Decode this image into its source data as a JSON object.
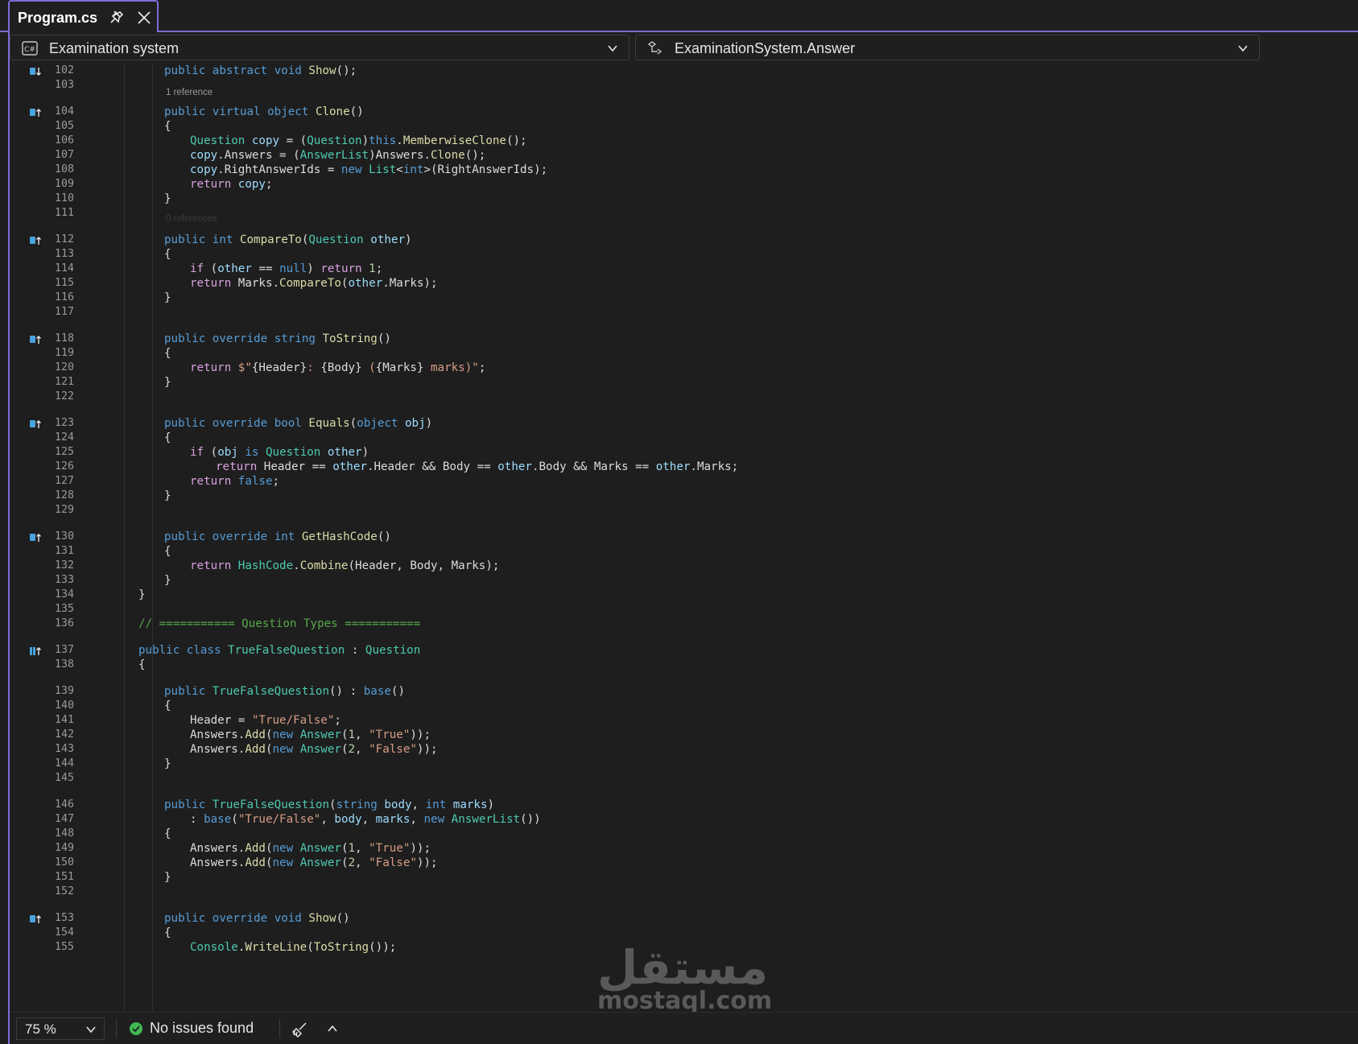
{
  "tab": {
    "title": "Program.cs"
  },
  "navbar": {
    "project": "Examination system",
    "member": "ExaminationSystem.Answer"
  },
  "colors": {
    "accent": "#7f6bd6",
    "background": "#1e1e1e",
    "keyword": "#569cd6",
    "type": "#4ec9b0",
    "method": "#dcdcaa",
    "string": "#d69d85",
    "comment": "#57a64a",
    "ok": "#3fb950"
  },
  "editor": {
    "lens_1": "1 reference",
    "lens_2": "0 references",
    "lines": [
      {
        "n": "102",
        "t": "public abstract void Show();"
      },
      {
        "n": "103",
        "t": ""
      },
      {
        "n": "104",
        "t": "public virtual object Clone()"
      },
      {
        "n": "105",
        "t": "{"
      },
      {
        "n": "106",
        "t": "Question copy = (Question)this.MemberwiseClone();"
      },
      {
        "n": "107",
        "t": "copy.Answers = (AnswerList)Answers.Clone();"
      },
      {
        "n": "108",
        "t": "copy.RightAnswerIds = new List<int>(RightAnswerIds);"
      },
      {
        "n": "109",
        "t": "return copy;"
      },
      {
        "n": "110",
        "t": "}"
      },
      {
        "n": "111",
        "t": ""
      },
      {
        "n": "112",
        "t": "public int CompareTo(Question other)"
      },
      {
        "n": "113",
        "t": "{"
      },
      {
        "n": "114",
        "t": "if (other == null) return 1;"
      },
      {
        "n": "115",
        "t": "return Marks.CompareTo(other.Marks);"
      },
      {
        "n": "116",
        "t": "}"
      },
      {
        "n": "117",
        "t": ""
      },
      {
        "n": "118",
        "t": "public override string ToString()"
      },
      {
        "n": "119",
        "t": "{"
      },
      {
        "n": "120",
        "t": "return $\"{Header}: {Body} ({Marks} marks)\";"
      },
      {
        "n": "121",
        "t": "}"
      },
      {
        "n": "122",
        "t": ""
      },
      {
        "n": "123",
        "t": "public override bool Equals(object obj)"
      },
      {
        "n": "124",
        "t": "{"
      },
      {
        "n": "125",
        "t": "if (obj is Question other)"
      },
      {
        "n": "126",
        "t": "return Header == other.Header && Body == other.Body && Marks == other.Marks;"
      },
      {
        "n": "127",
        "t": "return false;"
      },
      {
        "n": "128",
        "t": "}"
      },
      {
        "n": "129",
        "t": ""
      },
      {
        "n": "130",
        "t": "public override int GetHashCode()"
      },
      {
        "n": "131",
        "t": "{"
      },
      {
        "n": "132",
        "t": "return HashCode.Combine(Header, Body, Marks);"
      },
      {
        "n": "133",
        "t": "}"
      },
      {
        "n": "134",
        "t": "}"
      },
      {
        "n": "135",
        "t": ""
      },
      {
        "n": "136",
        "t": "// =========== Question Types ==========="
      },
      {
        "n": "137",
        "t": "public class TrueFalseQuestion : Question"
      },
      {
        "n": "138",
        "t": "{"
      },
      {
        "n": "139",
        "t": "public TrueFalseQuestion() : base()"
      },
      {
        "n": "140",
        "t": "{"
      },
      {
        "n": "141",
        "t": "Header = \"True/False\";"
      },
      {
        "n": "142",
        "t": "Answers.Add(new Answer(1, \"True\"));"
      },
      {
        "n": "143",
        "t": "Answers.Add(new Answer(2, \"False\"));"
      },
      {
        "n": "144",
        "t": "}"
      },
      {
        "n": "145",
        "t": ""
      },
      {
        "n": "146",
        "t": "public TrueFalseQuestion(string body, int marks)"
      },
      {
        "n": "147",
        "t": ": base(\"True/False\", body, marks, new AnswerList())"
      },
      {
        "n": "148",
        "t": "{"
      },
      {
        "n": "149",
        "t": "Answers.Add(new Answer(1, \"True\"));"
      },
      {
        "n": "150",
        "t": "Answers.Add(new Answer(2, \"False\"));"
      },
      {
        "n": "151",
        "t": "}"
      },
      {
        "n": "152",
        "t": ""
      },
      {
        "n": "153",
        "t": "public override void Show()"
      },
      {
        "n": "154",
        "t": "{"
      },
      {
        "n": "155",
        "t": "Console.WriteLine(ToString());"
      }
    ]
  },
  "watermark": {
    "arabic": "مستقل",
    "latin": "mostaql.com"
  },
  "status": {
    "zoom": "75 %",
    "issues": "No issues found"
  }
}
